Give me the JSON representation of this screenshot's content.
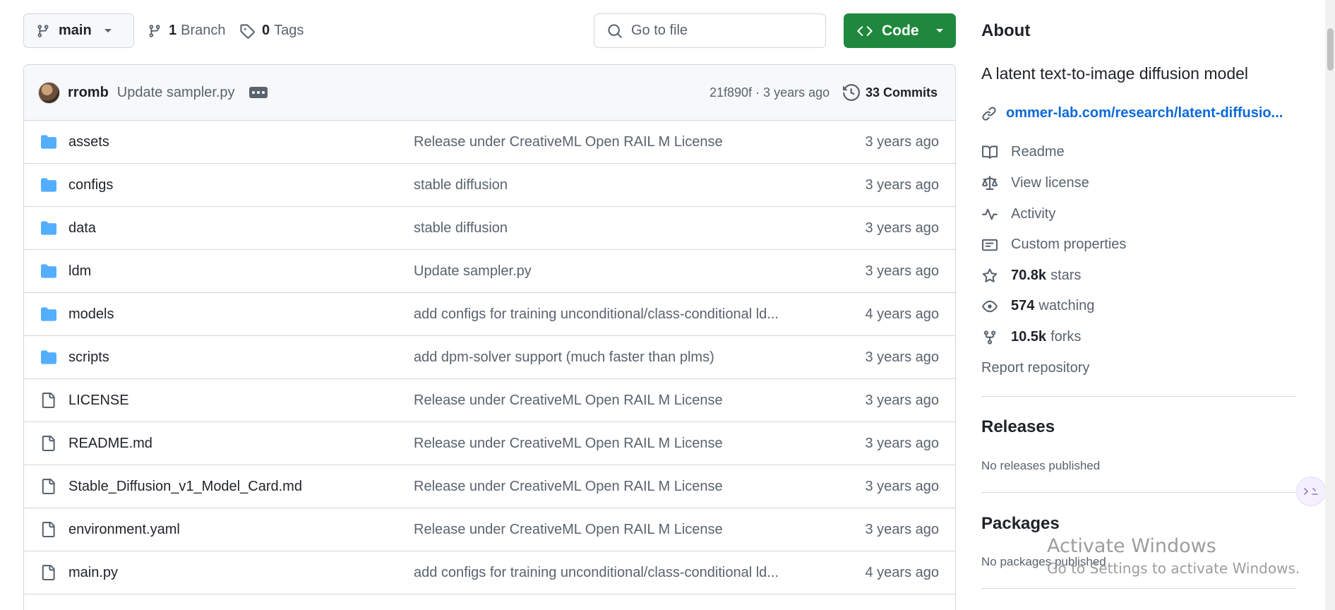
{
  "toolbar": {
    "branch": "main",
    "branches_count": "1",
    "branches_label": "Branch",
    "tags_count": "0",
    "tags_label": "Tags",
    "goto_placeholder": "Go to file",
    "code_label": "Code"
  },
  "commit": {
    "author": "rromb",
    "message": "Update sampler.py",
    "sha_time": "21f890f · 3 years ago",
    "commits_label": "33 Commits"
  },
  "files": [
    {
      "name": "assets",
      "type": "dir",
      "message": "Release under CreativeML Open RAIL M License",
      "age": "3 years ago"
    },
    {
      "name": "configs",
      "type": "dir",
      "message": "stable diffusion",
      "age": "3 years ago"
    },
    {
      "name": "data",
      "type": "dir",
      "message": "stable diffusion",
      "age": "3 years ago"
    },
    {
      "name": "ldm",
      "type": "dir",
      "message": "Update sampler.py",
      "age": "3 years ago"
    },
    {
      "name": "models",
      "type": "dir",
      "message": "add configs for training unconditional/class-conditional ld...",
      "age": "4 years ago"
    },
    {
      "name": "scripts",
      "type": "dir",
      "message": "add dpm-solver support (much faster than plms)",
      "age": "3 years ago"
    },
    {
      "name": "LICENSE",
      "type": "file",
      "message": "Release under CreativeML Open RAIL M License",
      "age": "3 years ago"
    },
    {
      "name": "README.md",
      "type": "file",
      "message": "Release under CreativeML Open RAIL M License",
      "age": "3 years ago"
    },
    {
      "name": "Stable_Diffusion_v1_Model_Card.md",
      "type": "file",
      "message": "Release under CreativeML Open RAIL M License",
      "age": "3 years ago"
    },
    {
      "name": "environment.yaml",
      "type": "file",
      "message": "Release under CreativeML Open RAIL M License",
      "age": "3 years ago"
    },
    {
      "name": "main.py",
      "type": "file",
      "message": "add configs for training unconditional/class-conditional ld...",
      "age": "4 years ago"
    }
  ],
  "about": {
    "heading": "About",
    "description": "A latent text-to-image diffusion model",
    "link": "ommer-lab.com/research/latent-diffusio...",
    "readme": "Readme",
    "license": "View license",
    "activity": "Activity",
    "custom_properties": "Custom properties",
    "stars_count": "70.8k",
    "stars_label": "stars",
    "watching_count": "574",
    "watching_label": "watching",
    "forks_count": "10.5k",
    "forks_label": "forks",
    "report": "Report repository"
  },
  "releases": {
    "heading": "Releases",
    "empty": "No releases published"
  },
  "packages": {
    "heading": "Packages",
    "empty": "No packages published"
  },
  "watermark": {
    "line1": "Activate Windows",
    "line2": "Go to Settings to activate Windows."
  },
  "colors": {
    "accent_green": "#1f883d",
    "link_blue": "#0969da",
    "folder_blue": "#54aeff",
    "muted_text": "#59636e",
    "border": "#d0d7de"
  }
}
